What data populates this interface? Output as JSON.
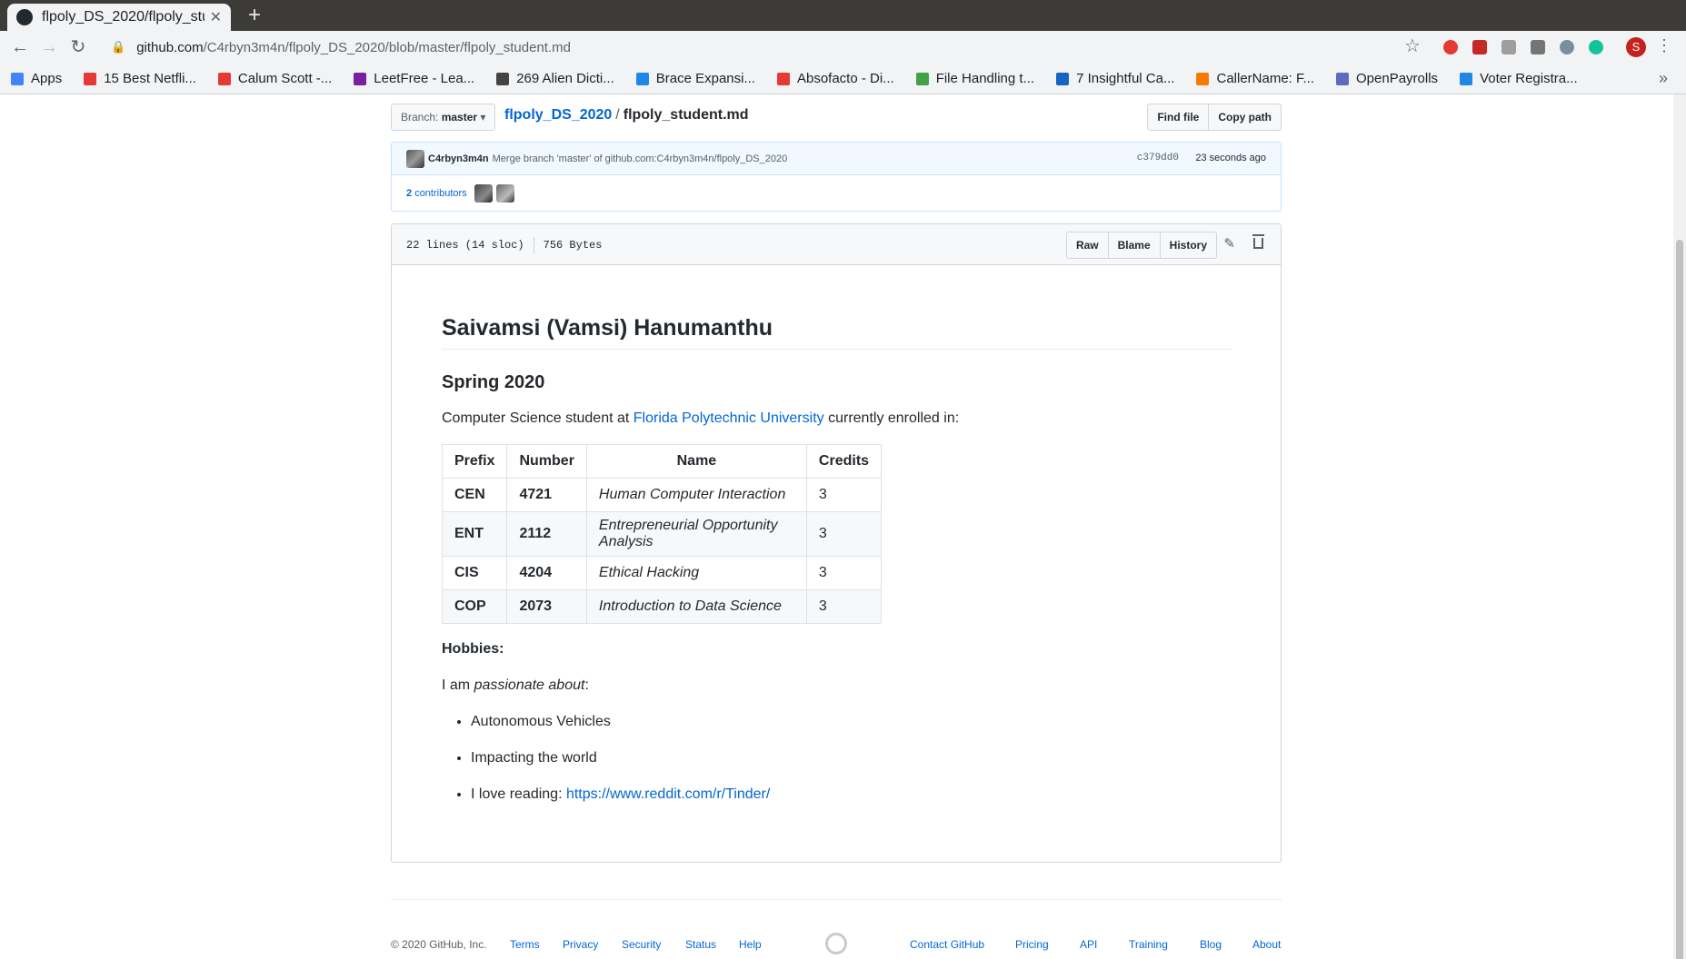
{
  "browser": {
    "tab_title": "flpoly_DS_2020/flpoly_stu",
    "url_host": "github.com",
    "url_path": "/C4rbyn3m4n/flpoly_DS_2020/blob/master/flpoly_student.md",
    "profile_initial": "S",
    "bookmarks": [
      {
        "label": "Apps",
        "color": "#4285f4"
      },
      {
        "label": "15 Best Netfli...",
        "color": "#e53935"
      },
      {
        "label": "Calum Scott -...",
        "color": "#e53935"
      },
      {
        "label": "LeetFree - Lea...",
        "color": "#7b1fa2"
      },
      {
        "label": "269 Alien Dicti...",
        "color": "#444444"
      },
      {
        "label": "Brace Expansi...",
        "color": "#1e88e5"
      },
      {
        "label": "Absofacto - Di...",
        "color": "#e53935"
      },
      {
        "label": "File Handling t...",
        "color": "#43a047"
      },
      {
        "label": "7 Insightful Ca...",
        "color": "#1565c0"
      },
      {
        "label": "CallerName: F...",
        "color": "#f57c00"
      },
      {
        "label": "OpenPayrolls",
        "color": "#5c6bc0"
      },
      {
        "label": "Voter Registra...",
        "color": "#1e88e5"
      }
    ]
  },
  "repo": {
    "branch_prefix": "Branch:",
    "branch": "master",
    "repo_name": "flpoly_DS_2020",
    "sep": "/",
    "file_name": "flpoly_student.md",
    "find_file": "Find file",
    "copy_path": "Copy path"
  },
  "commit": {
    "author": "C4rbyn3m4n",
    "message": "Merge branch 'master' of github.com:C4rbyn3m4n/flpoly_DS_2020",
    "sha": "c379dd0",
    "time": "23 seconds ago",
    "contributors_count": "2",
    "contributors_label": "contributors"
  },
  "file": {
    "lines": "22 lines (14 sloc)",
    "size": "756 Bytes",
    "raw": "Raw",
    "blame": "Blame",
    "history": "History"
  },
  "readme": {
    "h1": "Saivamsi (Vamsi) Hanumanthu",
    "h2": "Spring 2020",
    "intro_before": "Computer Science student at ",
    "intro_link": "Florida Polytechnic University",
    "intro_after": " currently enrolled in:",
    "table_headers": [
      "Prefix",
      "Number",
      "Name",
      "Credits"
    ],
    "courses": [
      [
        "CEN",
        "4721",
        "Human Computer Interaction",
        "3"
      ],
      [
        "ENT",
        "2112",
        "Entrepreneurial Opportunity Analysis",
        "3"
      ],
      [
        "CIS",
        "4204",
        "Ethical Hacking",
        "3"
      ],
      [
        "COP",
        "2073",
        "Introduction to Data Science",
        "3"
      ]
    ],
    "hobbies_title": "Hobbies:",
    "passion_before": "I am ",
    "passion_em": "passionate about",
    "passion_after": ":",
    "list": [
      "Autonomous Vehicles",
      "Impacting the world"
    ],
    "reading_label": "I love reading: ",
    "reading_link": "https://www.reddit.com/r/Tinder/"
  },
  "footer": {
    "copyright": "© 2020 GitHub, Inc.",
    "terms": "Terms",
    "privacy": "Privacy",
    "security": "Security",
    "status": "Status",
    "help": "Help",
    "contact": "Contact GitHub",
    "pricing": "Pricing",
    "api": "API",
    "training": "Training",
    "blog": "Blog",
    "about": "About"
  }
}
